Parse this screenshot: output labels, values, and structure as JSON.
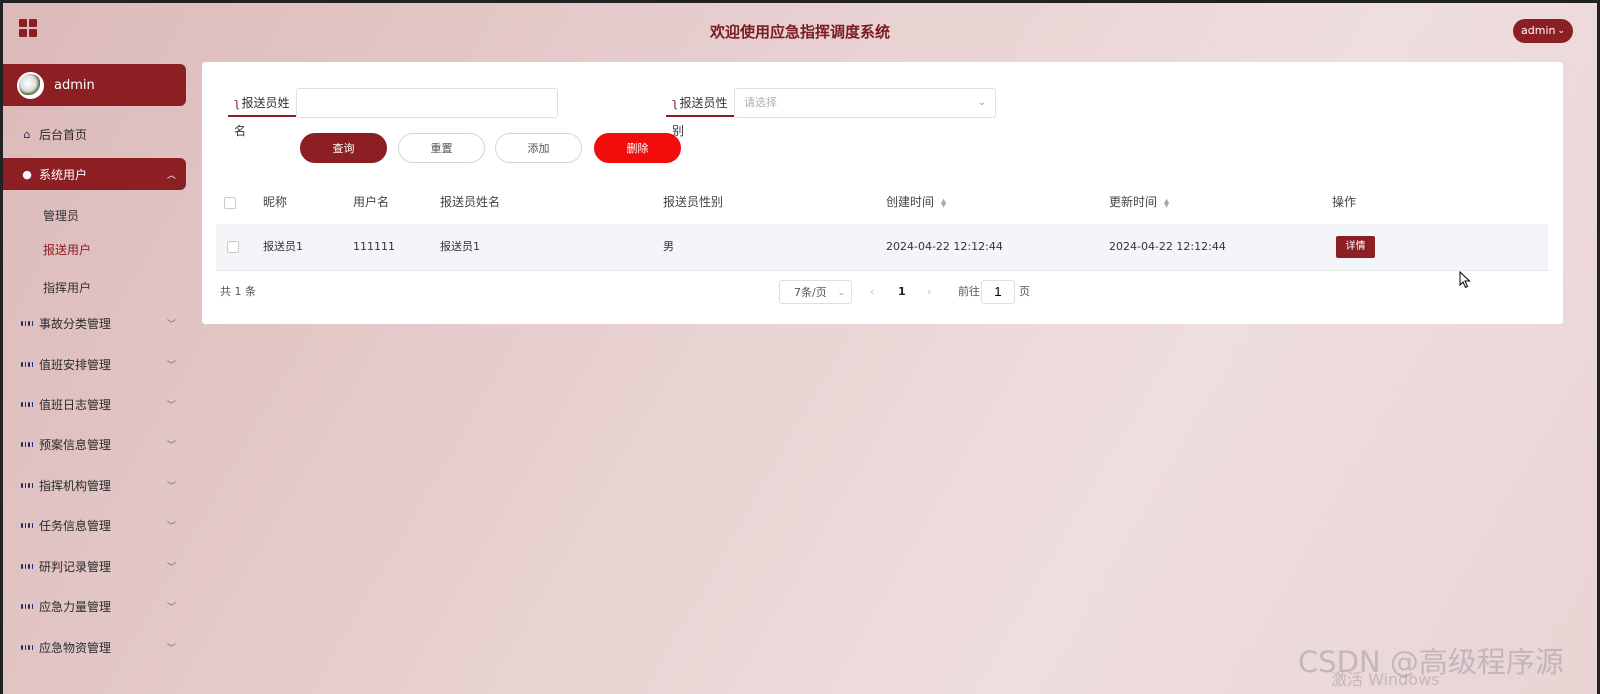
{
  "header": {
    "title": "欢迎使用应急指挥调度系统",
    "user": "admin"
  },
  "sidebar": {
    "profile_name": "admin",
    "home": "后台首页",
    "system_users": "系统用户",
    "sub_items": [
      "管理员",
      "报送用户",
      "指挥用户"
    ],
    "menus": [
      "事故分类管理",
      "值班安排管理",
      "值班日志管理",
      "预案信息管理",
      "指挥机构管理",
      "任务信息管理",
      "研判记录管理",
      "应急力量管理",
      "应急物资管理"
    ]
  },
  "search": {
    "name_label": "报送员姓名",
    "name_value": "",
    "gender_label": "报送员性别",
    "gender_placeholder": "请选择"
  },
  "buttons": {
    "query": "查询",
    "reset": "重置",
    "add": "添加",
    "delete": "删除"
  },
  "table": {
    "columns": [
      "昵称",
      "用户名",
      "报送员姓名",
      "报送员性别",
      "创建时间",
      "更新时间",
      "操作"
    ],
    "rows": [
      {
        "nickname": "报送员1",
        "username": "111111",
        "name": "报送员1",
        "gender": "男",
        "created": "2024-04-22 12:12:44",
        "updated": "2024-04-22 12:12:44",
        "action": "详情"
      }
    ]
  },
  "pagination": {
    "total_text": "共 1 条",
    "page_size": "7条/页",
    "current_page": "1",
    "goto_prefix": "前往",
    "goto_value": "1",
    "goto_suffix": "页"
  },
  "watermark": {
    "csdn": "CSDN @高级程序源",
    "activate": "激活 Windows"
  }
}
